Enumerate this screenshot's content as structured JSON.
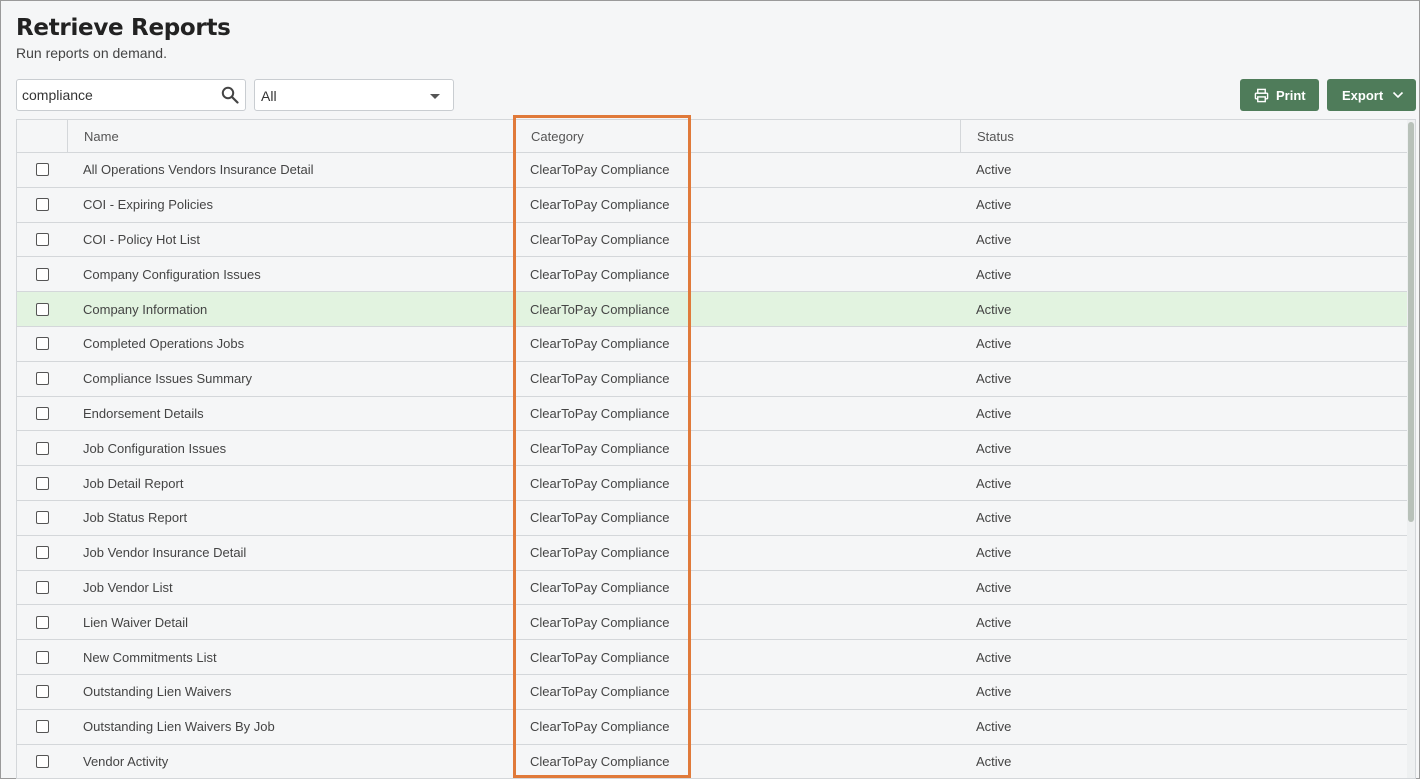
{
  "page": {
    "title": "Retrieve Reports",
    "subtitle": "Run reports on demand."
  },
  "search": {
    "value": "compliance",
    "placeholder": "",
    "icon": "search-icon"
  },
  "filter": {
    "selected": "All",
    "icon": "chevron-down-icon"
  },
  "toolbar": {
    "print_label": "Print",
    "print_icon": "printer-icon",
    "export_label": "Export",
    "export_icon": "chevron-down-icon",
    "button_color": "#4f7c5a"
  },
  "table": {
    "columns": [
      "Name",
      "Category",
      "Status"
    ],
    "rows": [
      {
        "name": "All Operations Vendors Insurance Detail",
        "category": "ClearToPay Compliance",
        "status": "Active"
      },
      {
        "name": "COI - Expiring Policies",
        "category": "ClearToPay Compliance",
        "status": "Active"
      },
      {
        "name": "COI - Policy Hot List",
        "category": "ClearToPay Compliance",
        "status": "Active"
      },
      {
        "name": "Company Configuration Issues",
        "category": "ClearToPay Compliance",
        "status": "Active"
      },
      {
        "name": "Company Information",
        "category": "ClearToPay Compliance",
        "status": "Active",
        "highlighted": true
      },
      {
        "name": "Completed Operations Jobs",
        "category": "ClearToPay Compliance",
        "status": "Active"
      },
      {
        "name": "Compliance Issues Summary",
        "category": "ClearToPay Compliance",
        "status": "Active"
      },
      {
        "name": "Endorsement Details",
        "category": "ClearToPay Compliance",
        "status": "Active"
      },
      {
        "name": "Job Configuration Issues",
        "category": "ClearToPay Compliance",
        "status": "Active"
      },
      {
        "name": "Job Detail Report",
        "category": "ClearToPay Compliance",
        "status": "Active"
      },
      {
        "name": "Job Status Report",
        "category": "ClearToPay Compliance",
        "status": "Active"
      },
      {
        "name": "Job Vendor Insurance Detail",
        "category": "ClearToPay Compliance",
        "status": "Active"
      },
      {
        "name": "Job Vendor List",
        "category": "ClearToPay Compliance",
        "status": "Active"
      },
      {
        "name": "Lien Waiver Detail",
        "category": "ClearToPay Compliance",
        "status": "Active"
      },
      {
        "name": "New Commitments List",
        "category": "ClearToPay Compliance",
        "status": "Active"
      },
      {
        "name": "Outstanding Lien Waivers",
        "category": "ClearToPay Compliance",
        "status": "Active"
      },
      {
        "name": "Outstanding Lien Waivers By Job",
        "category": "ClearToPay Compliance",
        "status": "Active"
      },
      {
        "name": "Vendor Activity",
        "category": "ClearToPay Compliance",
        "status": "Active"
      }
    ],
    "highlight_row_color": "#e2f3e0"
  },
  "annotation": {
    "highlight_color": "#e07a3a"
  }
}
